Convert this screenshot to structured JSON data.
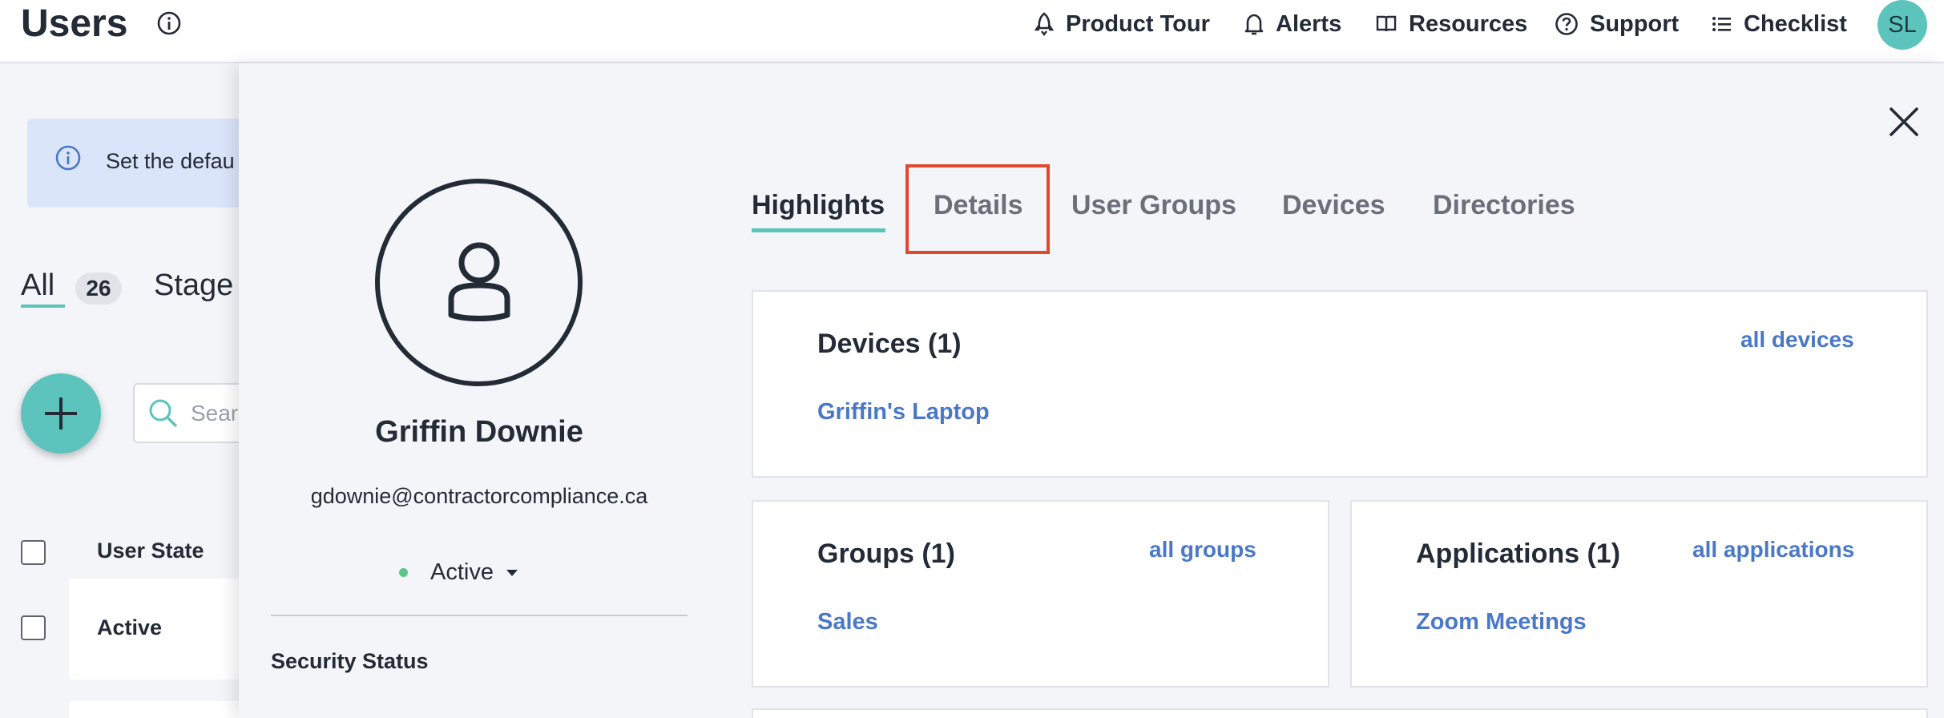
{
  "header": {
    "title": "Users",
    "nav": [
      {
        "label": "Product Tour",
        "icon": "rocket-icon"
      },
      {
        "label": "Alerts",
        "icon": "bell-icon"
      },
      {
        "label": "Resources",
        "icon": "book-icon"
      },
      {
        "label": "Support",
        "icon": "question-circle-icon"
      },
      {
        "label": "Checklist",
        "icon": "list-icon"
      }
    ],
    "avatar_initials": "SL"
  },
  "background": {
    "banner_text": "Set the defau",
    "tabs": [
      {
        "label": "All",
        "count": "26"
      },
      {
        "label": "Stage"
      }
    ],
    "search_placeholder": "Sear",
    "column_header": "User State",
    "rows": [
      {
        "state": "Active"
      }
    ]
  },
  "drawer": {
    "user": {
      "name": "Griffin Downie",
      "email": "gdownie@contractorcompliance.ca",
      "status": "Active"
    },
    "security_status_label": "Security Status",
    "tabs": [
      {
        "label": "Highlights",
        "active": true
      },
      {
        "label": "Details",
        "active": false
      },
      {
        "label": "User Groups",
        "active": false
      },
      {
        "label": "Devices",
        "active": false
      },
      {
        "label": "Directories",
        "active": false
      }
    ],
    "cards": {
      "devices": {
        "title": "Devices (1)",
        "link": "all devices",
        "items": [
          "Griffin's Laptop"
        ]
      },
      "groups": {
        "title": "Groups (1)",
        "link": "all groups",
        "items": [
          "Sales"
        ]
      },
      "applications": {
        "title": "Applications (1)",
        "link": "all applications",
        "items": [
          "Zoom Meetings"
        ]
      }
    }
  },
  "colors": {
    "accent": "#5cc4bd",
    "link": "#4a78c8",
    "highlight_border": "#e0492f",
    "status_active": "#5cc48a"
  }
}
